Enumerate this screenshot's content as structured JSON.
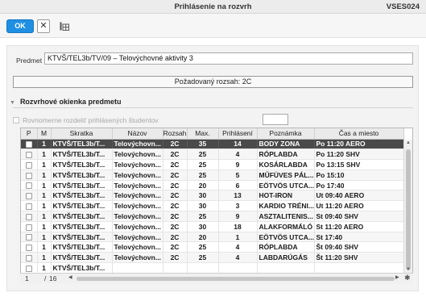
{
  "window": {
    "title": "Prihlásenie na rozvrh",
    "code": "VSES024"
  },
  "toolbar": {
    "ok_label": "OK",
    "close_glyph": "✕",
    "grid_tool_icon": "table-settings-icon"
  },
  "predmet": {
    "label": "Predmet",
    "value": "KTVŠ/TEL3b/TV/09 – Telovýchovné aktivity 3"
  },
  "rozsah": {
    "text": "Požadovaný rozsah: 2C"
  },
  "section": {
    "title": "Rozvrhové okienka predmetu",
    "toggle_icon": "collapse-triangle-icon"
  },
  "distribute": {
    "label": "Rovnomerne rozdeliť prihlásených študentov",
    "checked": false,
    "value": ""
  },
  "grid": {
    "columns": [
      "P",
      "M",
      "Skratka",
      "Názov",
      "Rozsah",
      "Max.",
      "Prihlásení",
      "Poznámka",
      "Čas a miesto"
    ],
    "rows": [
      {
        "m": "1",
        "skratka": "KTVŠ/TEL3b/T...",
        "nazov": "Telovýchovn...",
        "rozsah": "2C",
        "max": "35",
        "prihlaseni": "14",
        "poznamka": "BODY ZONA",
        "cas": "Po 11:20 AERO",
        "selected": true
      },
      {
        "m": "1",
        "skratka": "KTVŠ/TEL3b/T...",
        "nazov": "Telovýchovn...",
        "rozsah": "2C",
        "max": "25",
        "prihlaseni": "4",
        "poznamka": "RÓPLABDA",
        "cas": "Po 11:20 SHV"
      },
      {
        "m": "1",
        "skratka": "KTVŠ/TEL3b/T...",
        "nazov": "Telovýchovn...",
        "rozsah": "2C",
        "max": "25",
        "prihlaseni": "9",
        "poznamka": "KOSÁRLABDA",
        "cas": "Po 13:15 SHV"
      },
      {
        "m": "1",
        "skratka": "KTVŠ/TEL3b/T...",
        "nazov": "Telovýchovn...",
        "rozsah": "2C",
        "max": "25",
        "prihlaseni": "5",
        "poznamka": "MŰFÜVES PÁL...",
        "cas": "Po 15:10"
      },
      {
        "m": "1",
        "skratka": "KTVŠ/TEL3b/T...",
        "nazov": "Telovýchovn...",
        "rozsah": "2C",
        "max": "20",
        "prihlaseni": "6",
        "poznamka": "EÖTVÖS UTCA...",
        "cas": "Po 17:40"
      },
      {
        "m": "1",
        "skratka": "KTVŠ/TEL3b/T...",
        "nazov": "Telovýchovn...",
        "rozsah": "2C",
        "max": "30",
        "prihlaseni": "13",
        "poznamka": "HOT-IRON",
        "cas": "Ut 09:40 AERO"
      },
      {
        "m": "1",
        "skratka": "KTVŠ/TEL3b/T...",
        "nazov": "Telovýchovn...",
        "rozsah": "2C",
        "max": "30",
        "prihlaseni": "3",
        "poznamka": "KARDIO TRÉNI...",
        "cas": "Ut 11:20 AERO"
      },
      {
        "m": "1",
        "skratka": "KTVŠ/TEL3b/T...",
        "nazov": "Telovýchovn...",
        "rozsah": "2C",
        "max": "25",
        "prihlaseni": "9",
        "poznamka": "ASZTALITENIS...",
        "cas": "St 09:40 SHV"
      },
      {
        "m": "1",
        "skratka": "KTVŠ/TEL3b/T...",
        "nazov": "Telovýchovn...",
        "rozsah": "2C",
        "max": "30",
        "prihlaseni": "18",
        "poznamka": "ALAKFORMÁLÓ",
        "cas": "St 11:20 AERO"
      },
      {
        "m": "1",
        "skratka": "KTVŠ/TEL3b/T...",
        "nazov": "Telovýchovn...",
        "rozsah": "2C",
        "max": "20",
        "prihlaseni": "1",
        "poznamka": "EÖTVÖS UTCA...",
        "cas": "St 17:40"
      },
      {
        "m": "1",
        "skratka": "KTVŠ/TEL3b/T...",
        "nazov": "Telovýchovn...",
        "rozsah": "2C",
        "max": "25",
        "prihlaseni": "4",
        "poznamka": "RÓPLABDA",
        "cas": "Št 09:40 SHV"
      },
      {
        "m": "1",
        "skratka": "KTVŠ/TEL3b/T...",
        "nazov": "Telovýchovn...",
        "rozsah": "2C",
        "max": "25",
        "prihlaseni": "4",
        "poznamka": "LABDARÚGÁS",
        "cas": "Št 11:20 SHV"
      }
    ],
    "partial_row": {
      "m": "1",
      "skratka": "KTVŠ/TEL3b/T..."
    },
    "pager": {
      "current": "1",
      "separator": "/",
      "total": "16"
    }
  }
}
